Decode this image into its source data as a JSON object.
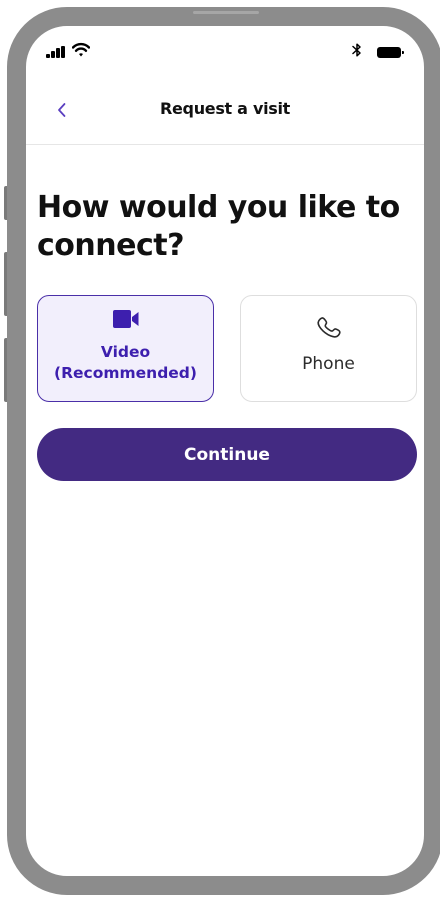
{
  "header": {
    "title": "Request a visit"
  },
  "main": {
    "question": "How would you like to connect?",
    "options": [
      {
        "label": "Video\n(Recommended)",
        "icon": "video-camera-icon",
        "selected": true
      },
      {
        "label": "Phone",
        "icon": "phone-icon",
        "selected": false
      }
    ],
    "continue_label": "Continue"
  },
  "colors": {
    "accent": "#432a82",
    "selected_text": "#3d1fae",
    "selected_bg": "#f2effc",
    "back_chevron": "#5a3fc0"
  }
}
